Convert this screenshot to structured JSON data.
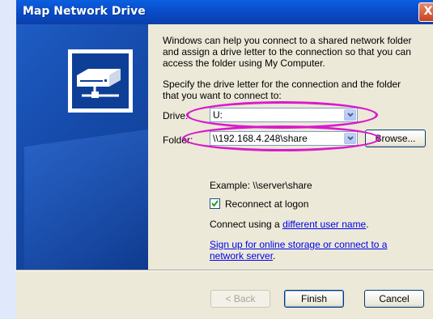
{
  "window": {
    "title": "Map Network Drive",
    "close_glyph": "X"
  },
  "intro": {
    "line1": "Windows can help you connect to a shared network folder",
    "line2": "and assign a drive letter to the connection so that you can",
    "line3": "access the folder using My Computer."
  },
  "specify": {
    "line1": "Specify the drive letter for the connection and the folder",
    "line2": "that you want to connect to:"
  },
  "drive": {
    "label": "Drive:",
    "value": "U:"
  },
  "folder": {
    "label": "Folder:",
    "value": "\\\\192.168.4.248\\share",
    "browse": "Browse..."
  },
  "example": "Example: \\\\server\\share",
  "reconnect": {
    "label": "Reconnect at logon",
    "checked": true
  },
  "connect_as": {
    "prefix": "Connect using a ",
    "link": "different user name",
    "suffix": "."
  },
  "signup": {
    "line1": "Sign up for online storage or connect to a",
    "line2": "network server",
    "suffix": "."
  },
  "buttons": {
    "back": "< Back",
    "finish": "Finish",
    "cancel": "Cancel"
  },
  "colors": {
    "annotation": "#d81acb",
    "title_bar": "#0a49c5"
  }
}
